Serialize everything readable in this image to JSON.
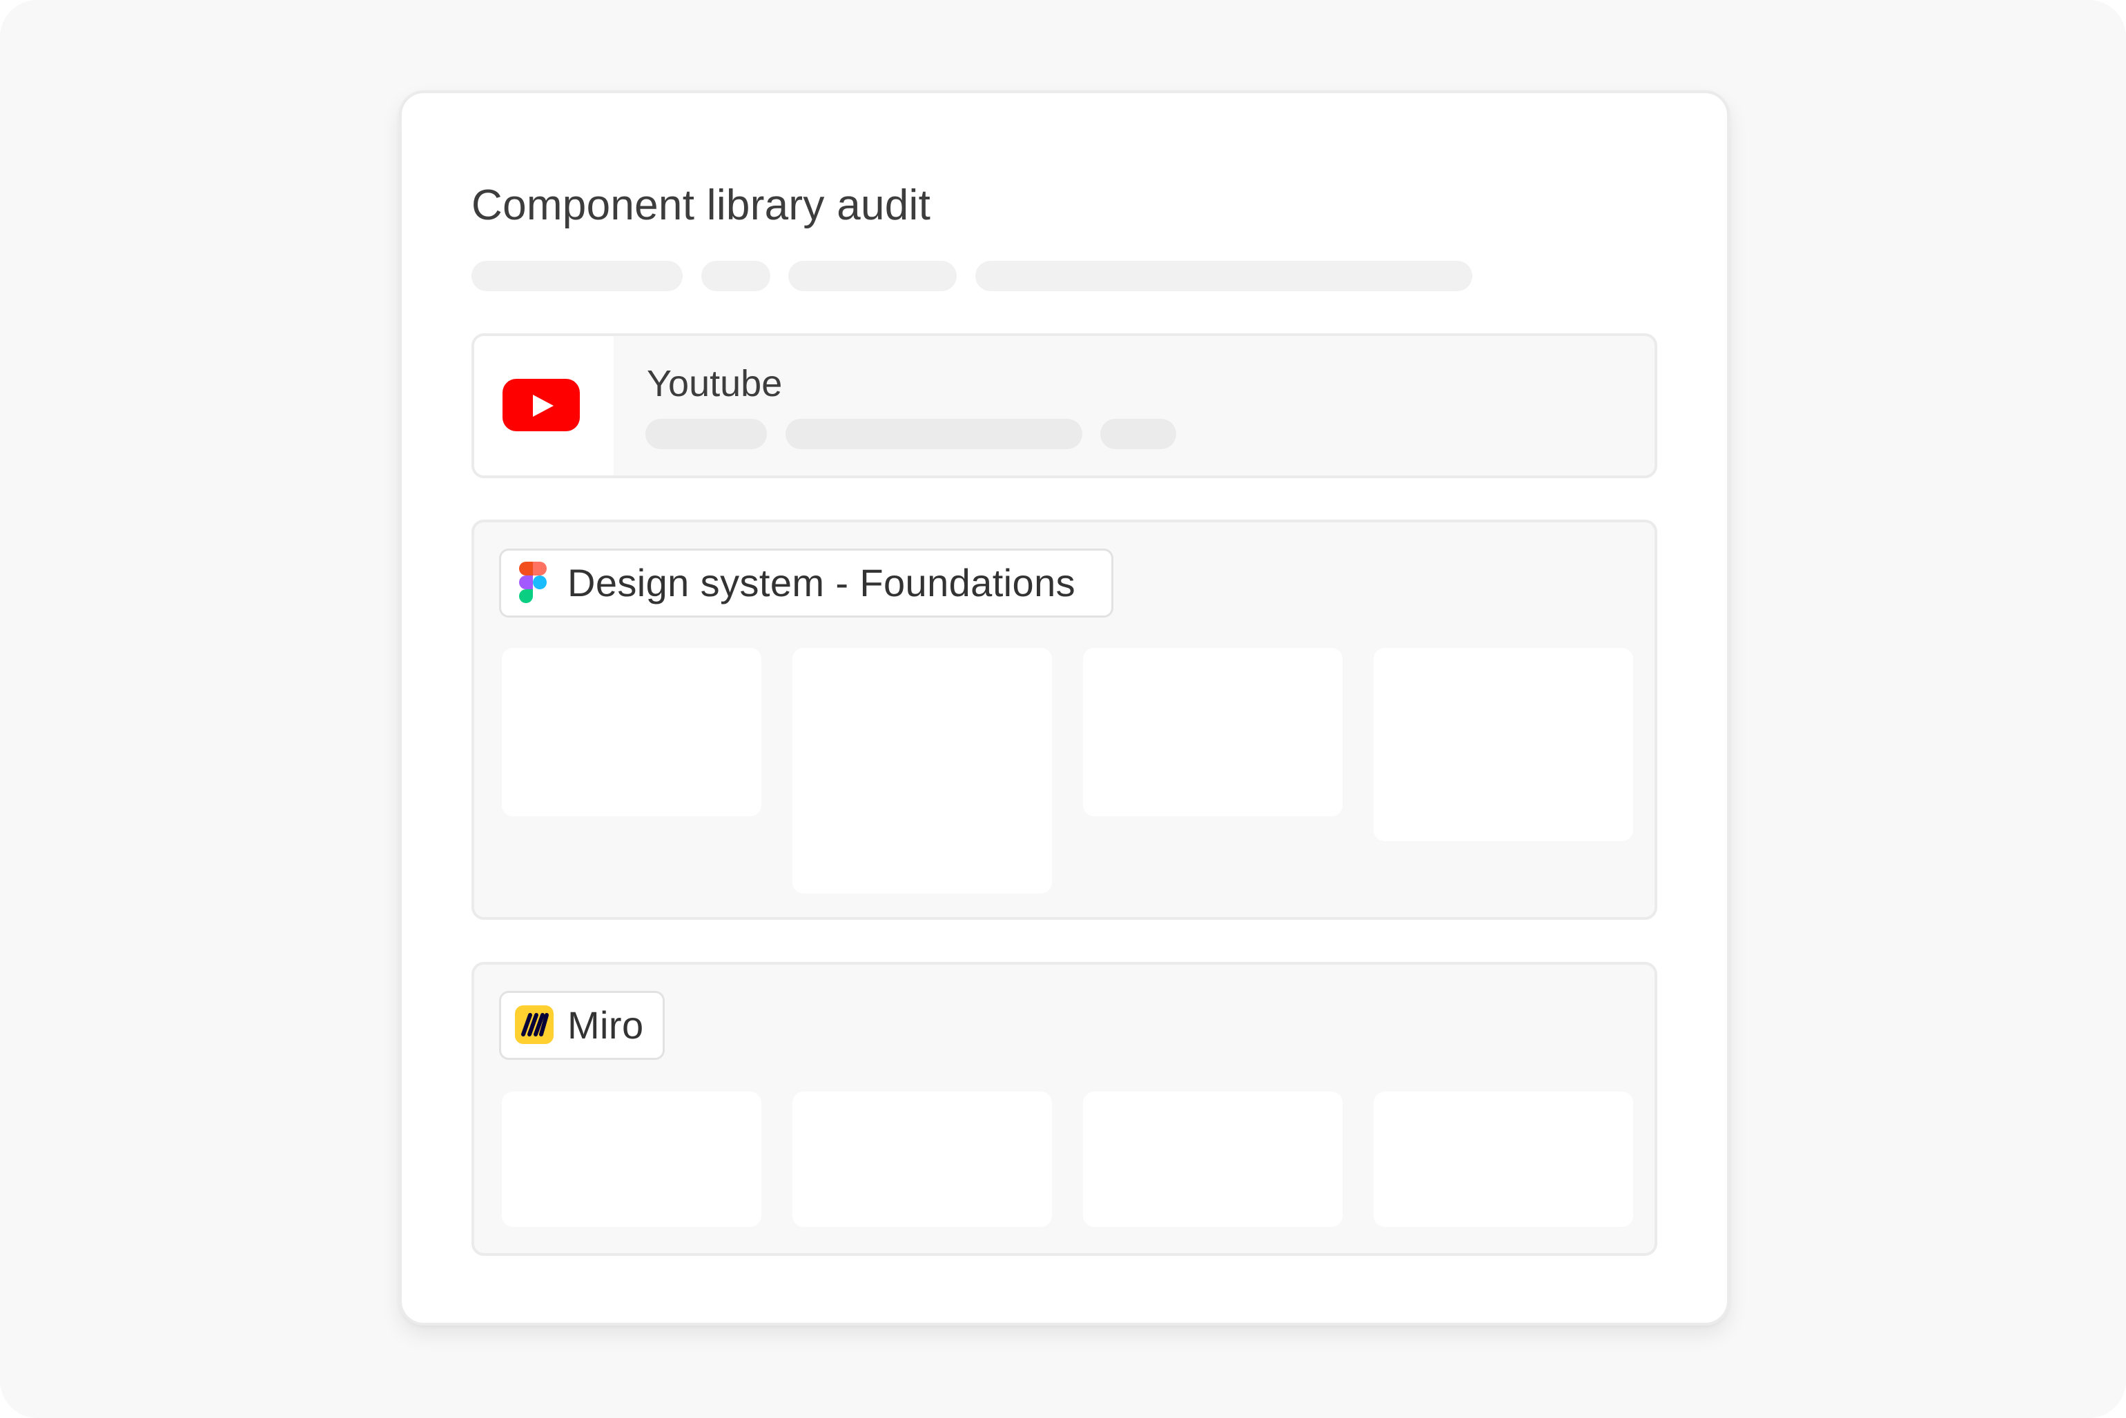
{
  "page": {
    "title": "Component library audit"
  },
  "cards": [
    {
      "name": "Youtube",
      "icon": "youtube-icon",
      "brand_color": "#ff0000"
    },
    {
      "name": "Design system - Foundations",
      "icon": "figma-icon"
    },
    {
      "name": "Miro",
      "icon": "miro-icon",
      "brand_color": "#ffd02f"
    }
  ],
  "colors": {
    "backdrop": "#f8f8f8",
    "card": "#ffffff",
    "panel": "#f8f8f8",
    "border": "#ebebeb",
    "skeleton": "#f1f1f1",
    "text": "#3d3d3d"
  }
}
